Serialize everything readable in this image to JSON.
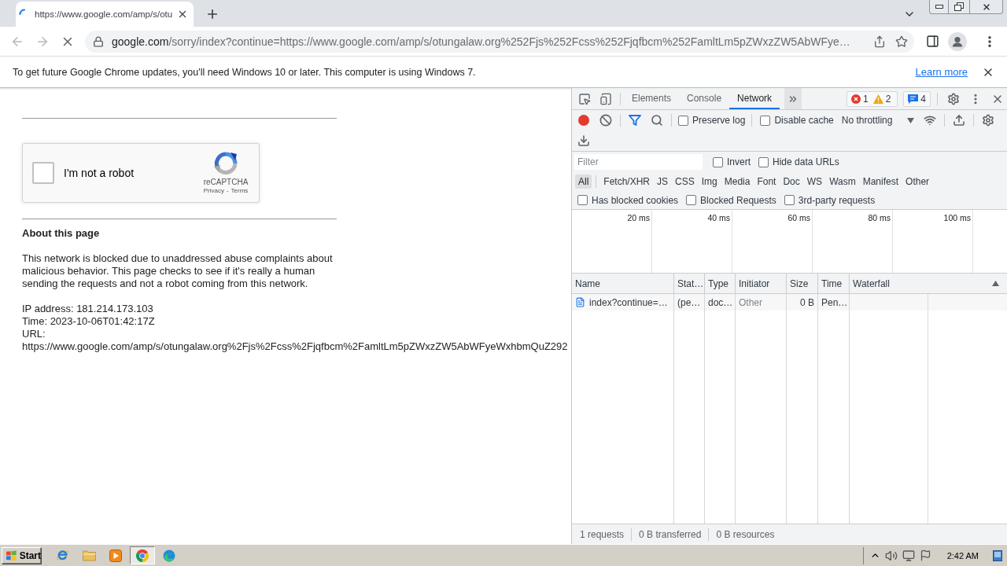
{
  "browser": {
    "tabs": [
      {
        "title": "https://www.google.com/amp/s/otu",
        "selected": true,
        "loading": true
      }
    ],
    "nav_buttons": [
      {
        "kind": "back",
        "disabled": true
      },
      {
        "kind": "forward",
        "disabled": true
      },
      {
        "kind": "stop",
        "disabled": false
      }
    ],
    "address": {
      "host": "google.com",
      "path": "/sorry/index?continue=https://www.google.com/amp/s/otungalaw.org%252Fjs%252Fcss%252Fjqfbcm%252FamltLm5pZWxzZW5AbWFye…"
    }
  },
  "infobar": {
    "message": "To get future Google Chrome updates, you'll need Windows 10 or later. This computer is using Windows 7.",
    "link": "Learn more"
  },
  "page": {
    "captcha": {
      "label": "I'm not a robot",
      "checked": false,
      "brand": "reCAPTCHA",
      "links": [
        "Privacy",
        "Terms"
      ],
      "separator": "-"
    },
    "heading": "About this page",
    "paragraph": "This network is blocked due to unaddressed abuse complaints about malicious behavior. This page checks to see if it's really a human sending the requests and not a robot coming from this network.",
    "details": [
      "IP address: 181.214.173.103",
      "Time: 2023-10-06T01:42:17Z",
      "URL:",
      "https://www.google.com/amp/s/otungalaw.org%2Fjs%2Fcss%2Fjqfbcm%2FamltLm5pZWxzZW5AbWFyeWxhbmQuZ292"
    ]
  },
  "devtools": {
    "tabs": [
      {
        "label": "Elements",
        "selected": false
      },
      {
        "label": "Console",
        "selected": false
      },
      {
        "label": "Network",
        "selected": true
      }
    ],
    "issues": [
      {
        "kind": "error",
        "count": "1"
      },
      {
        "kind": "warning",
        "count": "2"
      }
    ],
    "messages": "4",
    "recording": true,
    "options": [
      {
        "label": "Preserve log",
        "checked": false
      },
      {
        "label": "Disable cache",
        "checked": false
      }
    ],
    "throttling": "No throttling",
    "filter": {
      "placeholder": "Filter"
    },
    "filter_options": [
      {
        "label": "Invert",
        "checked": false
      },
      {
        "label": "Hide data URLs",
        "checked": false
      }
    ],
    "type_filters": [
      {
        "label": "All",
        "selected": true
      },
      {
        "label": "Fetch/XHR",
        "selected": false
      },
      {
        "label": "JS",
        "selected": false
      },
      {
        "label": "CSS",
        "selected": false
      },
      {
        "label": "Img",
        "selected": false
      },
      {
        "label": "Media",
        "selected": false
      },
      {
        "label": "Font",
        "selected": false
      },
      {
        "label": "Doc",
        "selected": false
      },
      {
        "label": "WS",
        "selected": false
      },
      {
        "label": "Wasm",
        "selected": false
      },
      {
        "label": "Manifest",
        "selected": false
      },
      {
        "label": "Other",
        "selected": false
      }
    ],
    "request_filters": [
      {
        "label": "Has blocked cookies",
        "checked": false
      },
      {
        "label": "Blocked Requests",
        "checked": false
      },
      {
        "label": "3rd-party requests",
        "checked": false
      }
    ],
    "overview_ticks": [
      "20 ms",
      "40 ms",
      "60 ms",
      "80 ms",
      "100 ms"
    ],
    "table": {
      "columns": [
        "Name",
        "Stat…",
        "Type",
        "Initiator",
        "Size",
        "Time",
        "Waterfall"
      ],
      "rows": [
        {
          "cells": [
            "index?continue=…",
            "(pe…",
            "doc…",
            "Other",
            "0 B",
            "Pen…"
          ]
        }
      ]
    },
    "summary": [
      "1 requests",
      "0 B transferred",
      "0 B resources"
    ]
  },
  "taskbar": {
    "start": "Start",
    "apps": [
      {
        "kind": "ie",
        "active": false
      },
      {
        "kind": "folder",
        "active": false
      },
      {
        "kind": "media",
        "active": false
      },
      {
        "kind": "chrome",
        "active": true
      },
      {
        "kind": "edge",
        "active": false
      }
    ],
    "clock": "2:42 AM"
  }
}
